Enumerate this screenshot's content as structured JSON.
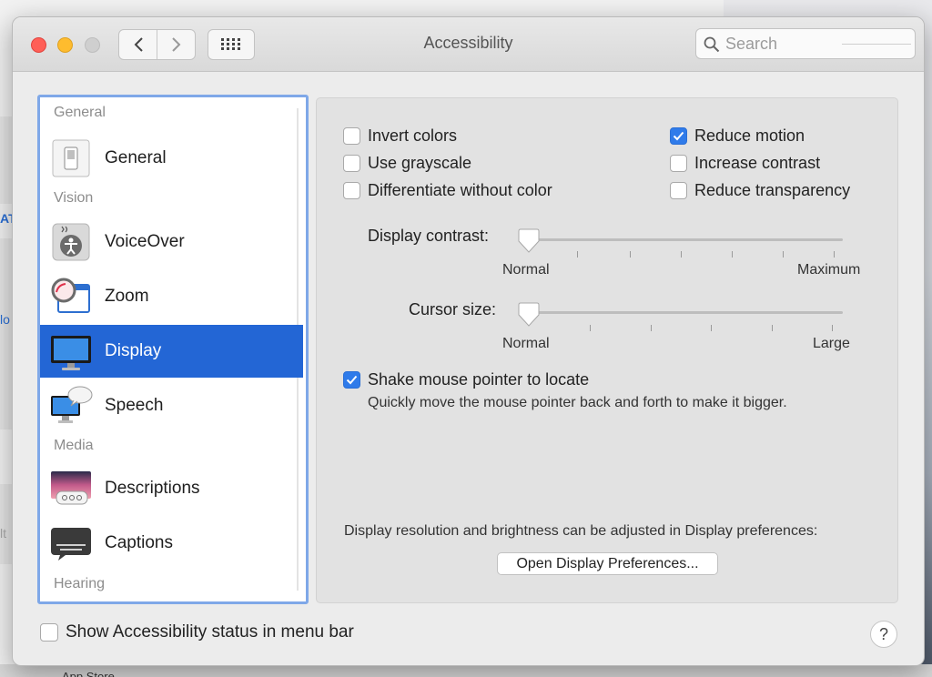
{
  "window": {
    "title": "Accessibility",
    "search_placeholder": "Search"
  },
  "background": {
    "letter_1": "AT",
    "letter_2": "lo",
    "letter_3": "lt",
    "bottom_text": "App Store"
  },
  "sidebar": {
    "sections": {
      "general": "General",
      "vision": "Vision",
      "media": "Media",
      "hearing": "Hearing"
    },
    "items": [
      {
        "label": "General",
        "icon": "switch-icon",
        "selected": false
      },
      {
        "label": "VoiceOver",
        "icon": "voiceover-icon",
        "selected": false
      },
      {
        "label": "Zoom",
        "icon": "zoom-icon",
        "selected": false
      },
      {
        "label": "Display",
        "icon": "display-icon",
        "selected": true
      },
      {
        "label": "Speech",
        "icon": "speech-icon",
        "selected": false
      },
      {
        "label": "Descriptions",
        "icon": "descriptions-icon",
        "selected": false
      },
      {
        "label": "Captions",
        "icon": "captions-icon",
        "selected": false
      }
    ]
  },
  "display": {
    "options": {
      "invert_colors": {
        "label": "Invert colors",
        "checked": false
      },
      "use_grayscale": {
        "label": "Use grayscale",
        "checked": false
      },
      "differentiate_without_color": {
        "label": "Differentiate without color",
        "checked": false
      },
      "reduce_motion": {
        "label": "Reduce motion",
        "checked": true
      },
      "increase_contrast": {
        "label": "Increase contrast",
        "checked": false
      },
      "reduce_transparency": {
        "label": "Reduce transparency",
        "checked": false
      }
    },
    "display_contrast": {
      "label": "Display contrast:",
      "min_label": "Normal",
      "max_label": "Maximum",
      "value": 0
    },
    "cursor_size": {
      "label": "Cursor size:",
      "min_label": "Normal",
      "max_label": "Large",
      "value": 0
    },
    "shake_pointer": {
      "label": "Shake mouse pointer to locate",
      "checked": true,
      "description": "Quickly move the mouse pointer back and forth to make it bigger."
    },
    "resolution_note": "Display resolution and brightness can be adjusted in Display preferences:",
    "open_button_label": "Open Display Preferences..."
  },
  "footer": {
    "show_status_label": "Show Accessibility status in menu bar",
    "show_status_checked": false,
    "help_label": "?"
  },
  "colors": {
    "accent": "#2f7bea",
    "selection": "#2366d5",
    "focus_ring": "#7fa8e8"
  }
}
